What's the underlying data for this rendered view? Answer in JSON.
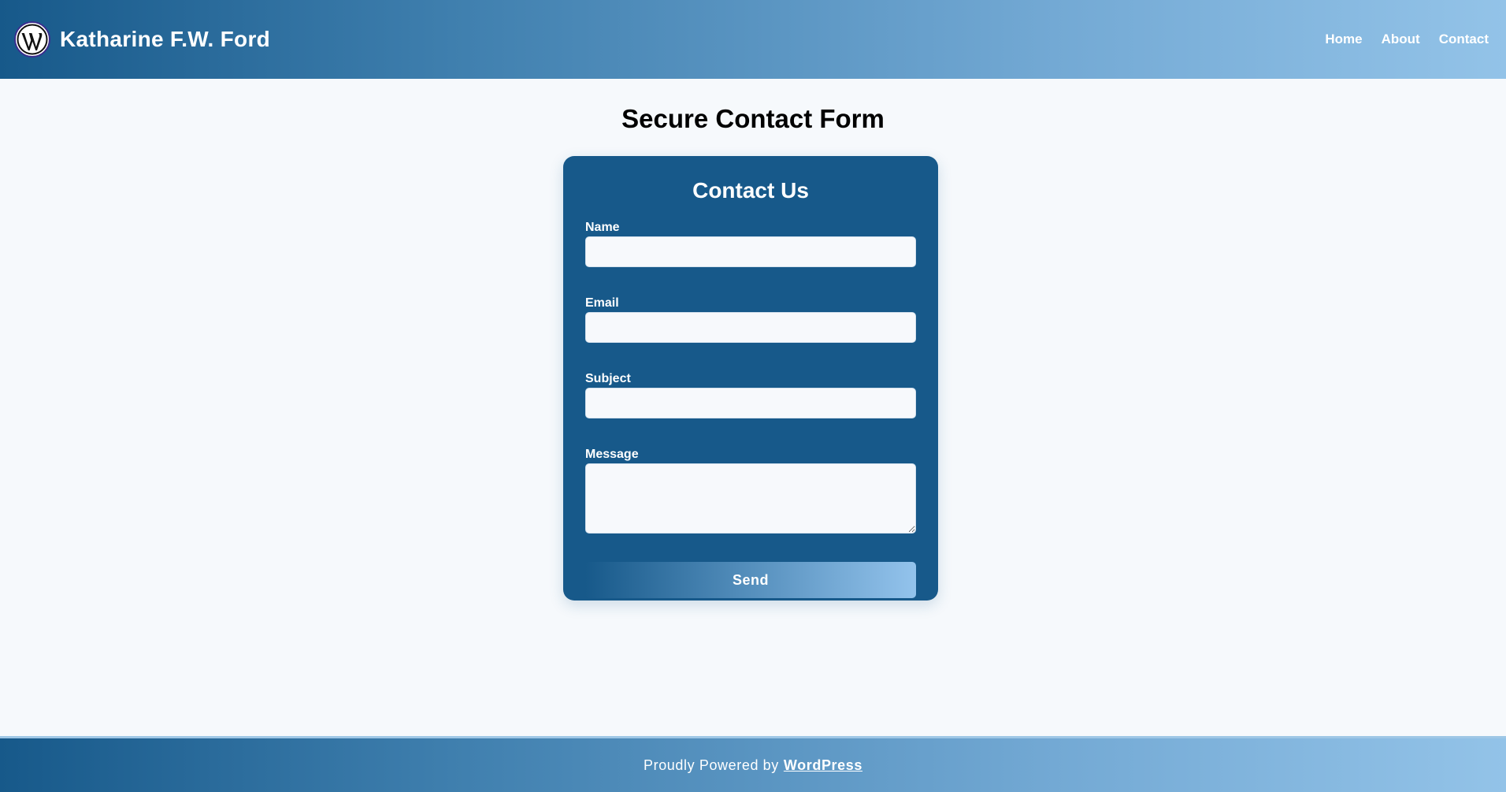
{
  "header": {
    "site_title": "Katharine F.W. Ford",
    "logo_icon": "wordpress-logo-icon",
    "nav": [
      {
        "label": "Home"
      },
      {
        "label": "About"
      },
      {
        "label": "Contact"
      }
    ]
  },
  "main": {
    "page_title": "Secure Contact Form",
    "form": {
      "title": "Contact Us",
      "fields": {
        "name": {
          "label": "Name",
          "value": "",
          "placeholder": ""
        },
        "email": {
          "label": "Email",
          "value": "",
          "placeholder": ""
        },
        "subject": {
          "label": "Subject",
          "value": "",
          "placeholder": ""
        },
        "message": {
          "label": "Message",
          "value": "",
          "placeholder": ""
        }
      },
      "submit_label": "Send"
    }
  },
  "footer": {
    "text": "Proudly Powered by",
    "link_label": "WordPress"
  },
  "colors": {
    "primary": "#17598a",
    "gradient_end": "#93c3e8",
    "background": "#f6f9fc",
    "text_on_primary": "#ffffff"
  }
}
